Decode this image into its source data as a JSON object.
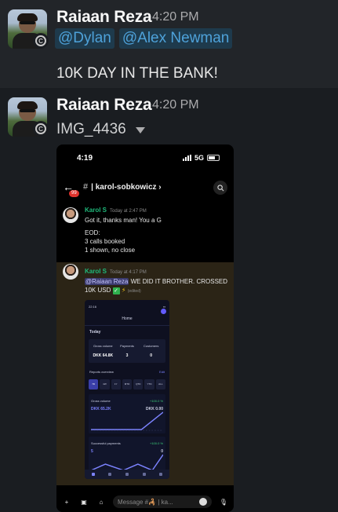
{
  "messages": [
    {
      "author": "Raiaan Reza",
      "time": "4:20 PM",
      "mentions": [
        "@Dylan",
        "@Alex Newman"
      ],
      "text": "10K DAY IN THE BANK!"
    },
    {
      "author": "Raiaan Reza",
      "time": "4:20 PM",
      "file_name": "IMG_4436",
      "attachment": {
        "status_time": "4:19",
        "network": "5G",
        "unread_count": "99",
        "channel_hash": "#",
        "channel_name": "| karol-sobkowicz ›",
        "posts": [
          {
            "author": "Karol S",
            "time": "Today at 2:47 PM",
            "lines": [
              "Got it, thanks man! You a G",
              "",
              "EOD:",
              "3 calls booked",
              "1 shown, no close"
            ]
          },
          {
            "author": "Karol S",
            "time": "Today at 4:17 PM",
            "mention": "@Raiaan Reza",
            "text": " WE DID IT BROTHER. CROSSED 10K USD",
            "edited": "(edited)"
          }
        ],
        "embedded": {
          "time": "22:16",
          "title": "Home",
          "today_label": "Today",
          "metrics": [
            {
              "label": "Gross volume",
              "value": "DKK 64.8K"
            },
            {
              "label": "Payments",
              "value": "3"
            },
            {
              "label": "Customers",
              "value": "0"
            }
          ],
          "reports_label": "Reports overview",
          "edit_label": "Edit",
          "ranges": [
            "7D",
            "4W",
            "1Y",
            "MTD",
            "QTD",
            "YTD",
            "ALL"
          ],
          "gross_label": "Gross volume",
          "gross_change": "+100.0 %",
          "gross_value": "DKK 65.2K",
          "gross_prev": "DKK 0.00",
          "payments_label": "Successful payments",
          "payments_change": "+100.0 %",
          "payments_value": "5",
          "payments_prev": "0"
        },
        "input_placeholder": "Message #",
        "input_suffix": "ka..."
      }
    }
  ],
  "colors": {
    "background": "#1a1d21",
    "highlight": "#222529",
    "mention_bg": "#1e3a4c",
    "mention_fg": "#4ea2da"
  }
}
